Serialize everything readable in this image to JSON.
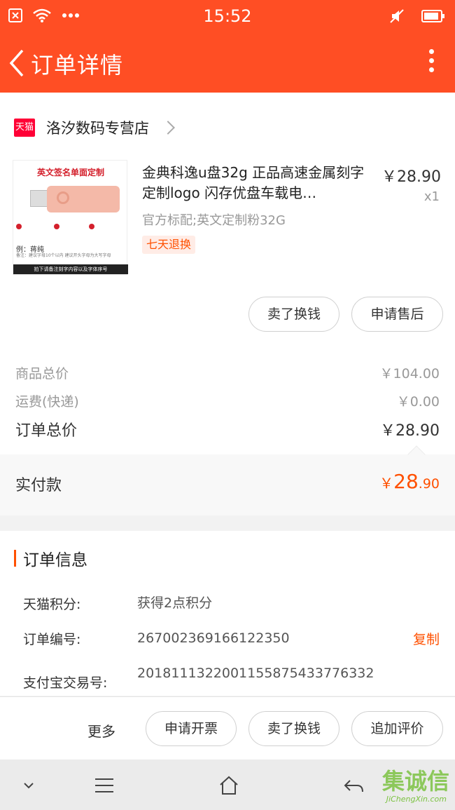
{
  "status_bar": {
    "time": "15:52"
  },
  "header": {
    "title": "订单详情"
  },
  "shop": {
    "badge": "天猫",
    "name": "洛汐数码专营店"
  },
  "product": {
    "image_title": "英文签名单面定制",
    "image_example": "例：蒋纯",
    "image_note": "备注：建议字母10个以内 建议开头字母为大写字母",
    "image_bar": "拍下请备注刻字内容以及字体序号",
    "title": "金典科逸u盘32g 正品高速金属刻字定制logo 闪存优盘车载电…",
    "price": "￥28.90",
    "qty": "x1",
    "spec": "官方标配;英文定制粉32G",
    "tag": "七天退换"
  },
  "item_buttons": {
    "sell": "卖了换钱",
    "after_sale": "申请售后"
  },
  "summary": {
    "goods_label": "商品总价",
    "goods_value": "￥104.00",
    "ship_label": "运费(快递)",
    "ship_value": "￥0.00",
    "total_label": "订单总价",
    "total_value": "￥28.90"
  },
  "paid": {
    "label": "实付款",
    "currency": "￥",
    "int": "28",
    "dec": ".90"
  },
  "order_info": {
    "title": "订单信息",
    "rows": [
      {
        "key": "天猫积分:",
        "value": "获得2点积分"
      },
      {
        "key": "订单编号:",
        "value": "267002369166122350"
      },
      {
        "key": "支付宝交易号:",
        "value": "2018111322001155875433776332"
      }
    ],
    "copy": "复制"
  },
  "actions": {
    "more": "更多",
    "invoice": "申请开票",
    "sell": "卖了换钱",
    "review": "追加评价"
  },
  "watermark": {
    "main": "集诚信",
    "sub": "JiChengXin.com"
  },
  "colors": {
    "brand": "#ff4e24",
    "accent": "#ff5000",
    "tmall": "#ff0036"
  }
}
